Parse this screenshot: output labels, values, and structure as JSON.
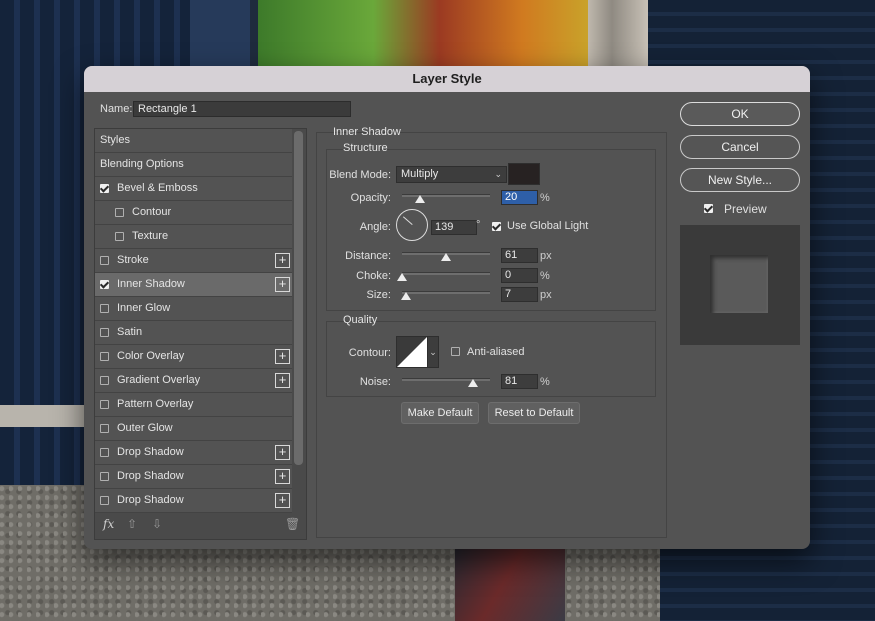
{
  "dialog": {
    "title": "Layer Style"
  },
  "name": {
    "label": "Name:",
    "value": "Rectangle 1"
  },
  "styles_list": [
    {
      "label": "Styles",
      "checkbox": "none",
      "indent": 0,
      "plus": false,
      "selected": false
    },
    {
      "label": "Blending Options",
      "checkbox": "none",
      "indent": 0,
      "plus": false,
      "selected": false
    },
    {
      "label": "Bevel & Emboss",
      "checkbox": "on",
      "indent": 0,
      "plus": false,
      "selected": false
    },
    {
      "label": "Contour",
      "checkbox": "off",
      "indent": 1,
      "plus": false,
      "selected": false
    },
    {
      "label": "Texture",
      "checkbox": "off",
      "indent": 1,
      "plus": false,
      "selected": false
    },
    {
      "label": "Stroke",
      "checkbox": "off",
      "indent": 0,
      "plus": true,
      "selected": false
    },
    {
      "label": "Inner Shadow",
      "checkbox": "on",
      "indent": 0,
      "plus": true,
      "selected": true
    },
    {
      "label": "Inner Glow",
      "checkbox": "off",
      "indent": 0,
      "plus": false,
      "selected": false
    },
    {
      "label": "Satin",
      "checkbox": "off",
      "indent": 0,
      "plus": false,
      "selected": false
    },
    {
      "label": "Color Overlay",
      "checkbox": "off",
      "indent": 0,
      "plus": true,
      "selected": false
    },
    {
      "label": "Gradient Overlay",
      "checkbox": "off",
      "indent": 0,
      "plus": true,
      "selected": false
    },
    {
      "label": "Pattern Overlay",
      "checkbox": "off",
      "indent": 0,
      "plus": false,
      "selected": false
    },
    {
      "label": "Outer Glow",
      "checkbox": "off",
      "indent": 0,
      "plus": false,
      "selected": false
    },
    {
      "label": "Drop Shadow",
      "checkbox": "off",
      "indent": 0,
      "plus": true,
      "selected": false
    },
    {
      "label": "Drop Shadow",
      "checkbox": "off",
      "indent": 0,
      "plus": true,
      "selected": false
    },
    {
      "label": "Drop Shadow",
      "checkbox": "off",
      "indent": 0,
      "plus": true,
      "selected": false
    }
  ],
  "footer": {
    "fx_label": "fx",
    "move_up": "⇧",
    "move_down": "⇩",
    "delete": "🗑"
  },
  "inner_shadow": {
    "title": "Inner Shadow",
    "structure": {
      "title": "Structure",
      "blend_mode_label": "Blend Mode:",
      "blend_mode_value": "Multiply",
      "shadow_color": "#272222",
      "opacity_label": "Opacity:",
      "opacity_value": "20",
      "opacity_unit": "%",
      "opacity_fraction": 0.2,
      "angle_label": "Angle:",
      "angle_value": "139",
      "angle_unit": "°",
      "global_light_label": "Use Global Light",
      "global_light_checked": true,
      "distance_label": "Distance:",
      "distance_value": "61",
      "distance_unit": "px",
      "distance_fraction": 0.5,
      "choke_label": "Choke:",
      "choke_value": "0",
      "choke_unit": "%",
      "choke_fraction": 0.0,
      "size_label": "Size:",
      "size_value": "7",
      "size_unit": "px",
      "size_fraction": 0.05
    },
    "quality": {
      "title": "Quality",
      "contour_label": "Contour:",
      "anti_aliased_label": "Anti-aliased",
      "anti_aliased_checked": false,
      "noise_label": "Noise:",
      "noise_value": "81",
      "noise_unit": "%",
      "noise_fraction": 0.81
    },
    "make_default_label": "Make Default",
    "reset_default_label": "Reset to Default"
  },
  "buttons": {
    "ok": "OK",
    "cancel": "Cancel",
    "new_style": "New Style..."
  },
  "preview": {
    "label": "Preview",
    "checked": true
  },
  "icons": {
    "plus": "+",
    "chevron": "⌄",
    "dropdown": "⌄"
  }
}
